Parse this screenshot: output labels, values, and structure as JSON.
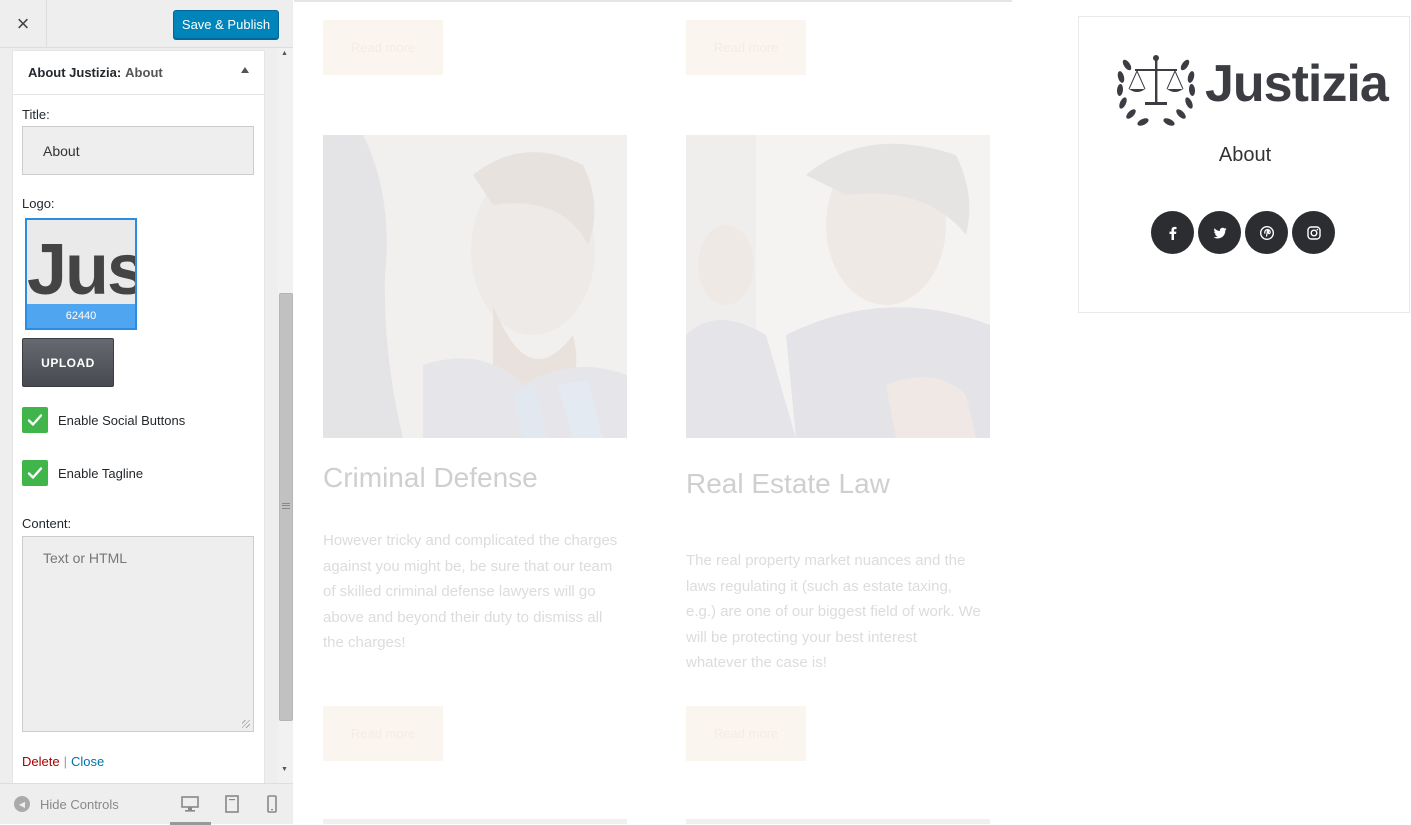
{
  "header": {
    "close_glyph": "×",
    "save_label": "Save & Publish"
  },
  "widget": {
    "heading_name": "About Justizia:",
    "heading_title": "About",
    "title_label": "Title:",
    "title_value": "About",
    "logo_label": "Logo:",
    "logo_preview_text": "Jus",
    "logo_id": "62440",
    "upload_label": "UPLOAD",
    "enable_social_label": "Enable Social Buttons",
    "enable_social_checked": true,
    "enable_tagline_label": "Enable Tagline",
    "enable_tagline_checked": true,
    "content_label": "Content:",
    "content_placeholder": "Text or HTML",
    "delete_label": "Delete",
    "separator": "|",
    "close_label": "Close"
  },
  "footer": {
    "hide_controls_label": "Hide Controls",
    "devices": [
      "desktop",
      "tablet",
      "mobile"
    ],
    "active_device": "desktop"
  },
  "preview": {
    "read_more_label": "Read more",
    "cards": [
      {
        "title": "Criminal Defense",
        "text": "However tricky and complicated the charges against you might be, be sure that our team of skilled criminal defense lawyers will go above and beyond their duty to dismiss all the charges!"
      },
      {
        "title": "Real Estate Law",
        "text": "The real property market nuances and the laws regulating it (such as estate taxing, e.g.) are one of our biggest field of work. We will be protecting your best interest whatever the case is!"
      }
    ],
    "about_widget": {
      "logo_text": "Justizia",
      "title": "About",
      "social_icons": [
        "facebook-icon",
        "twitter-icon",
        "pinterest-icon",
        "instagram-icon"
      ]
    }
  },
  "colors": {
    "save_button": "#0085ba",
    "checkbox": "#3fb54a",
    "logo_selected_border": "#2e8ce0",
    "social_circle": "#2b2d31",
    "delete_link": "#aa0000",
    "close_link": "#0073aa"
  }
}
